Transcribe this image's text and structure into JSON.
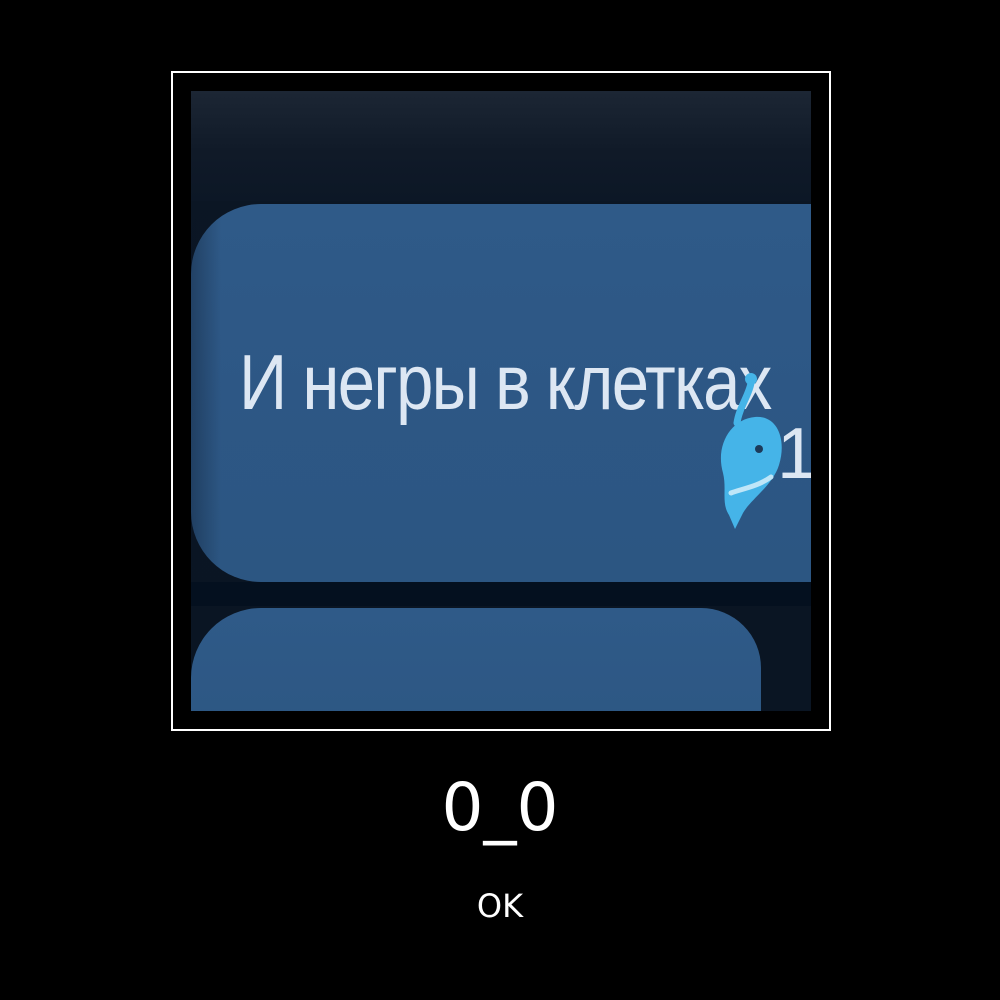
{
  "image": {
    "message_text": "И негры в клетках",
    "reaction": {
      "icon": "whale-icon",
      "count": "1",
      "color": "#45b4e8"
    },
    "colors": {
      "bubble": "#2d5785",
      "background": "#0c1726"
    }
  },
  "caption": {
    "title": "0_0",
    "subtitle": "OK"
  }
}
